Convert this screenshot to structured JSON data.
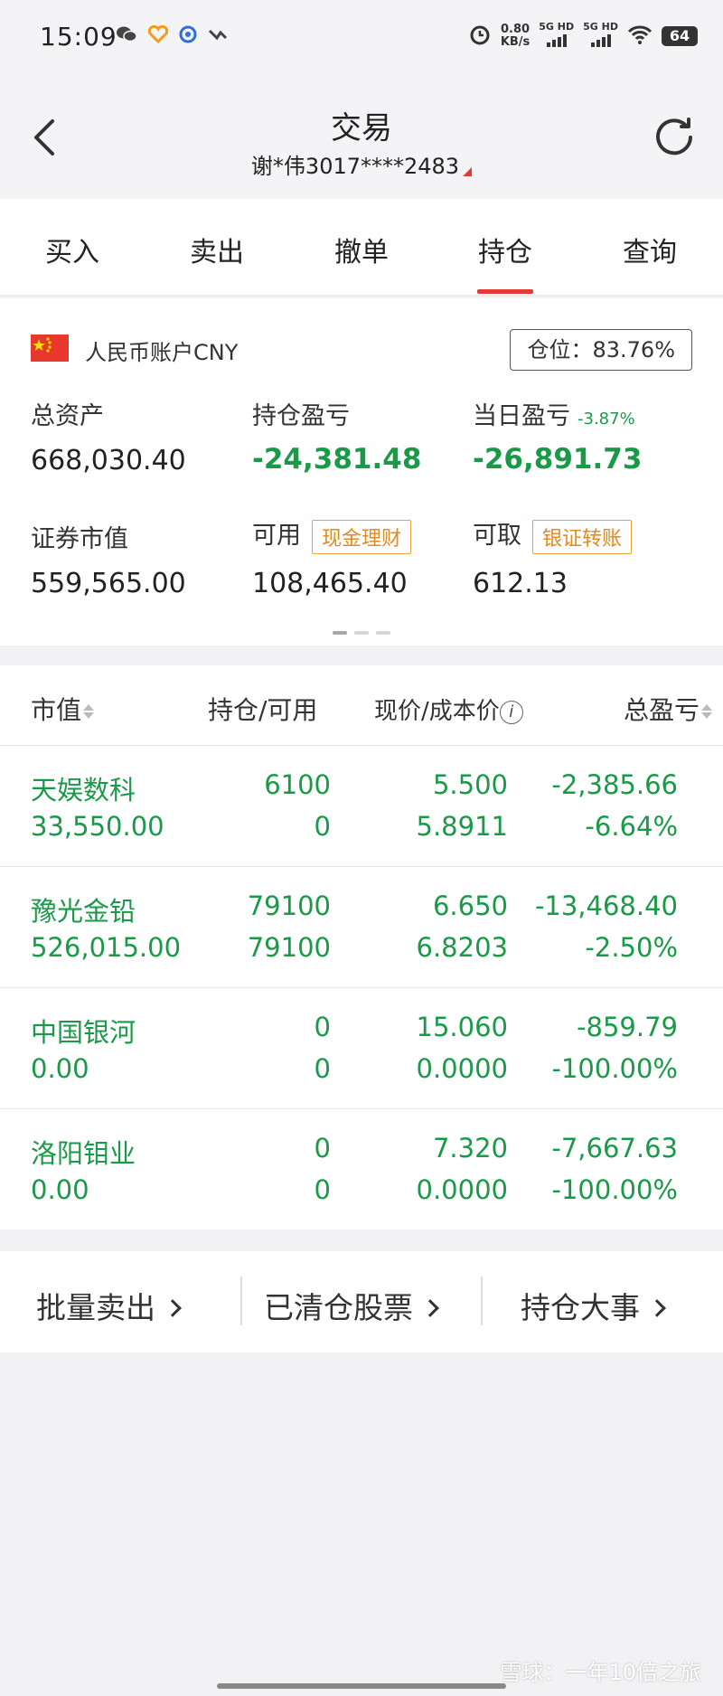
{
  "status_bar": {
    "time": "15:09",
    "speed_value": "0.80",
    "speed_unit": "KB/s",
    "net1": "5G HD",
    "net2": "5G HD",
    "battery": "64"
  },
  "header": {
    "title": "交易",
    "account": "谢*伟3017****2483"
  },
  "tabs": [
    {
      "label": "买入"
    },
    {
      "label": "卖出"
    },
    {
      "label": "撤单"
    },
    {
      "label": "持仓",
      "active": true
    },
    {
      "label": "查询"
    }
  ],
  "account_card": {
    "account_name": "人民币账户CNY",
    "position_ratio": "仓位：83.76%",
    "total_assets_label": "总资产",
    "total_assets": "668,030.40",
    "holding_pl_label": "持仓盈亏",
    "holding_pl": "-24,381.48",
    "daily_pl_label": "当日盈亏",
    "daily_pl_pct": "-3.87%",
    "daily_pl": "-26,891.73",
    "market_value_label": "证券市值",
    "market_value": "559,565.00",
    "available_label": "可用",
    "available_tag": "现金理财",
    "available": "108,465.40",
    "withdrawable_label": "可取",
    "withdrawable_tag": "银证转账",
    "withdrawable": "612.13"
  },
  "holdings": {
    "headers": {
      "market_value": "市值",
      "position": "持仓/可用",
      "price": "现价/成本价",
      "total_pl": "总盈亏"
    },
    "rows": [
      {
        "name": "天娱数科",
        "market_value": "33,550.00",
        "position": "6100",
        "available": "0",
        "price": "5.500",
        "cost": "5.8911",
        "pl": "-2,385.66",
        "pl_pct": "-6.64%"
      },
      {
        "name": "豫光金铅",
        "market_value": "526,015.00",
        "position": "79100",
        "available": "79100",
        "price": "6.650",
        "cost": "6.8203",
        "pl": "-13,468.40",
        "pl_pct": "-2.50%"
      },
      {
        "name": "中国银河",
        "market_value": "0.00",
        "position": "0",
        "available": "0",
        "price": "15.060",
        "cost": "0.0000",
        "pl": "-859.79",
        "pl_pct": "-100.00%"
      },
      {
        "name": "洛阳钼业",
        "market_value": "0.00",
        "position": "0",
        "available": "0",
        "price": "7.320",
        "cost": "0.0000",
        "pl": "-7,667.63",
        "pl_pct": "-100.00%"
      }
    ]
  },
  "actions": {
    "batch_sell": "批量卖出",
    "cleared_stocks": "已清仓股票",
    "holding_events": "持仓大事"
  },
  "watermark": "雪球：一年10倍之旅",
  "colors": {
    "loss_green": "#1a9a48",
    "accent_red": "#e53935",
    "tag_orange": "#e38a20"
  }
}
